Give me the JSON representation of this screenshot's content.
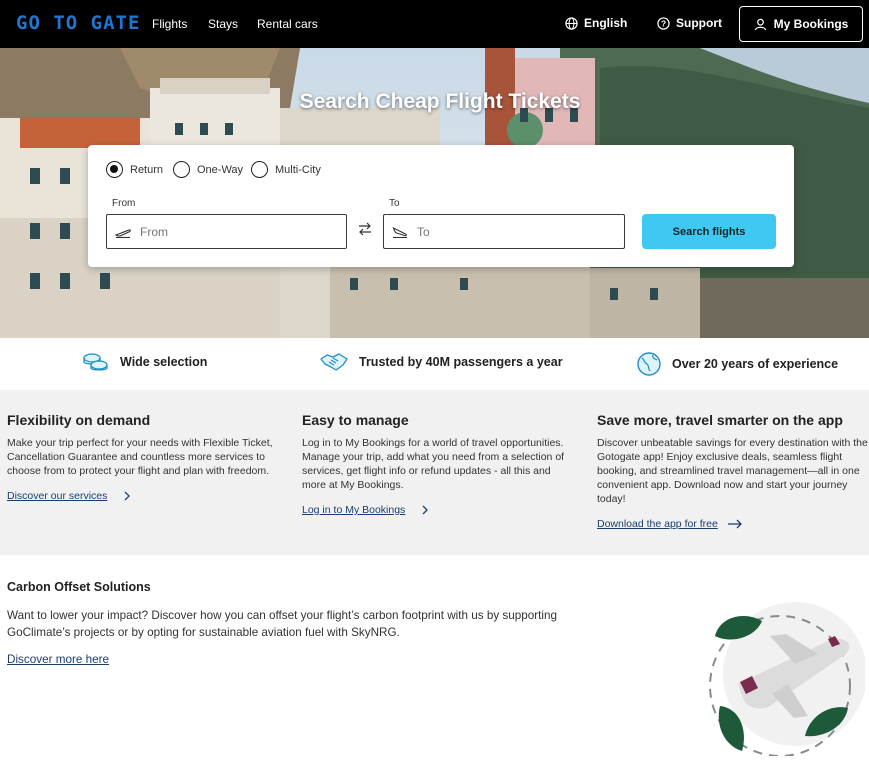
{
  "header": {
    "logo": "GO TO GATE",
    "nav": [
      "Flights",
      "Stays",
      "Rental cars"
    ],
    "language": "English",
    "support": "Support",
    "my_bookings": "My Bookings"
  },
  "hero": {
    "title": "Search Cheap Flight Tickets"
  },
  "search": {
    "trip_types": [
      "Return",
      "One-Way",
      "Multi-City"
    ],
    "selected_trip_type": "Return",
    "from_label": "From",
    "from_placeholder": "From",
    "to_label": "To",
    "to_placeholder": "To",
    "button": "Search flights"
  },
  "usps": [
    {
      "icon": "coins-icon",
      "text": "Wide selection"
    },
    {
      "icon": "handshake-icon",
      "text": "Trusted by 40M passengers a year"
    },
    {
      "icon": "globe-icon",
      "text": "Over 20 years of experience"
    }
  ],
  "features": [
    {
      "title": "Flexibility on demand",
      "text": "Make your trip perfect for your needs with Flexible Ticket, Cancellation Guarantee and countless more services to choose from to protect your flight and plan with freedom.",
      "link": "Discover our services"
    },
    {
      "title": "Easy to manage",
      "text": "Log in to My Bookings for a world of travel opportunities. Manage your trip, add what you need from a selection of services, get flight info or refund updates - all this and more at My Bookings.",
      "link": "Log in to My Bookings"
    },
    {
      "title": "Save more, travel smarter on the app",
      "text": "Discover unbeatable savings for every destination with the Gotogate app! Enjoy exclusive deals, seamless flight booking, and streamlined travel management—all in one convenient app. Download now and start your journey today!",
      "link": "Download the app for free"
    }
  ],
  "carbon": {
    "title": "Carbon Offset Solutions",
    "text": "Want to lower your impact? Discover how you can offset your flight’s carbon footprint with us by supporting GoClimate’s projects or by opting for sustainable aviation fuel with SkyNRG.",
    "link": "Discover more here"
  },
  "colors": {
    "accent": "#3ec8f2",
    "logo": "#1f76d1",
    "link": "#1a3d6e",
    "leaf": "#1d5a3a",
    "plane_tail": "#7a2a4a"
  }
}
